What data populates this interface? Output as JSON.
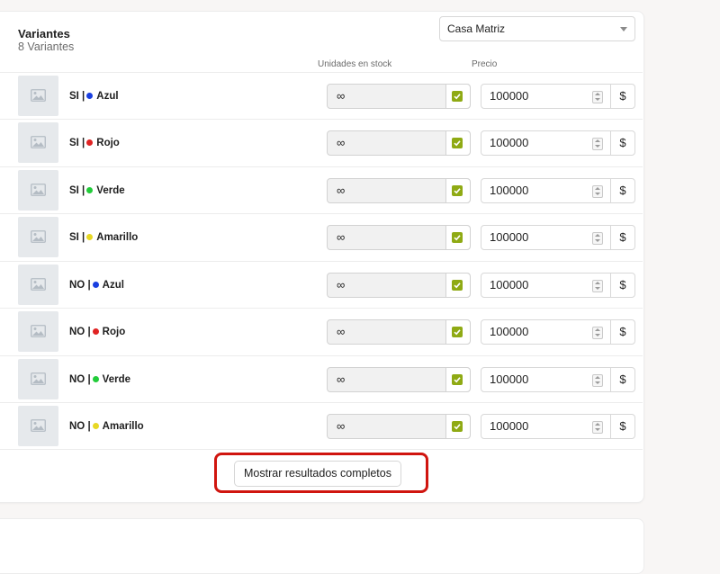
{
  "card": {
    "title": "Variantes",
    "subtitle": "8 Variantes",
    "location_select": "Casa Matriz"
  },
  "columns": {
    "stock": "Unidades en stock",
    "price": "Precio"
  },
  "variants": [
    {
      "prefix": "SI |",
      "color_name": "Azul",
      "dot_color": "#1a3fe0",
      "stock": "∞",
      "price": "100000",
      "currency": "$"
    },
    {
      "prefix": "SI |",
      "color_name": "Rojo",
      "dot_color": "#e02323",
      "stock": "∞",
      "price": "100000",
      "currency": "$"
    },
    {
      "prefix": "SI |",
      "color_name": "Verde",
      "dot_color": "#22cc3a",
      "stock": "∞",
      "price": "100000",
      "currency": "$"
    },
    {
      "prefix": "SI |",
      "color_name": "Amarillo",
      "dot_color": "#e7d824",
      "stock": "∞",
      "price": "100000",
      "currency": "$"
    },
    {
      "prefix": "NO |",
      "color_name": "Azul",
      "dot_color": "#1a3fe0",
      "stock": "∞",
      "price": "100000",
      "currency": "$"
    },
    {
      "prefix": "NO |",
      "color_name": "Rojo",
      "dot_color": "#e02323",
      "stock": "∞",
      "price": "100000",
      "currency": "$"
    },
    {
      "prefix": "NO |",
      "color_name": "Verde",
      "dot_color": "#22cc3a",
      "stock": "∞",
      "price": "100000",
      "currency": "$"
    },
    {
      "prefix": "NO |",
      "color_name": "Amarillo",
      "dot_color": "#e7d824",
      "stock": "∞",
      "price": "100000",
      "currency": "$"
    }
  ],
  "footer": {
    "show_all_label": "Mostrar resultados completos"
  },
  "colors": {
    "checkbox_accent": "#8faa14",
    "highlight_border": "#d0150f"
  }
}
